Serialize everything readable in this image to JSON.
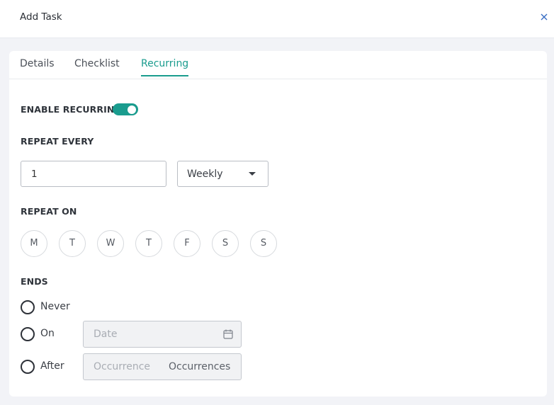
{
  "header": {
    "title": "Add Task",
    "close_icon": "close-icon"
  },
  "tabs": [
    {
      "label": "Details",
      "active": false
    },
    {
      "label": "Checklist",
      "active": false
    },
    {
      "label": "Recurring",
      "active": true
    }
  ],
  "recurring": {
    "enable_label": "ENABLE RECURRING",
    "enabled": true,
    "accent_color": "#1a9c8e",
    "repeat_every_label": "REPEAT EVERY",
    "interval_value": "1",
    "frequency": "Weekly",
    "repeat_on_label": "REPEAT ON",
    "days": [
      "M",
      "T",
      "W",
      "T",
      "F",
      "S",
      "S"
    ],
    "ends_label": "ENDS",
    "ends_options": [
      "Never",
      "On",
      "After"
    ],
    "date_placeholder": "Date",
    "calendar_icon": "calendar-icon",
    "occurrence_placeholder": "Occurrence",
    "occurrence_suffix": "Occurrences"
  }
}
